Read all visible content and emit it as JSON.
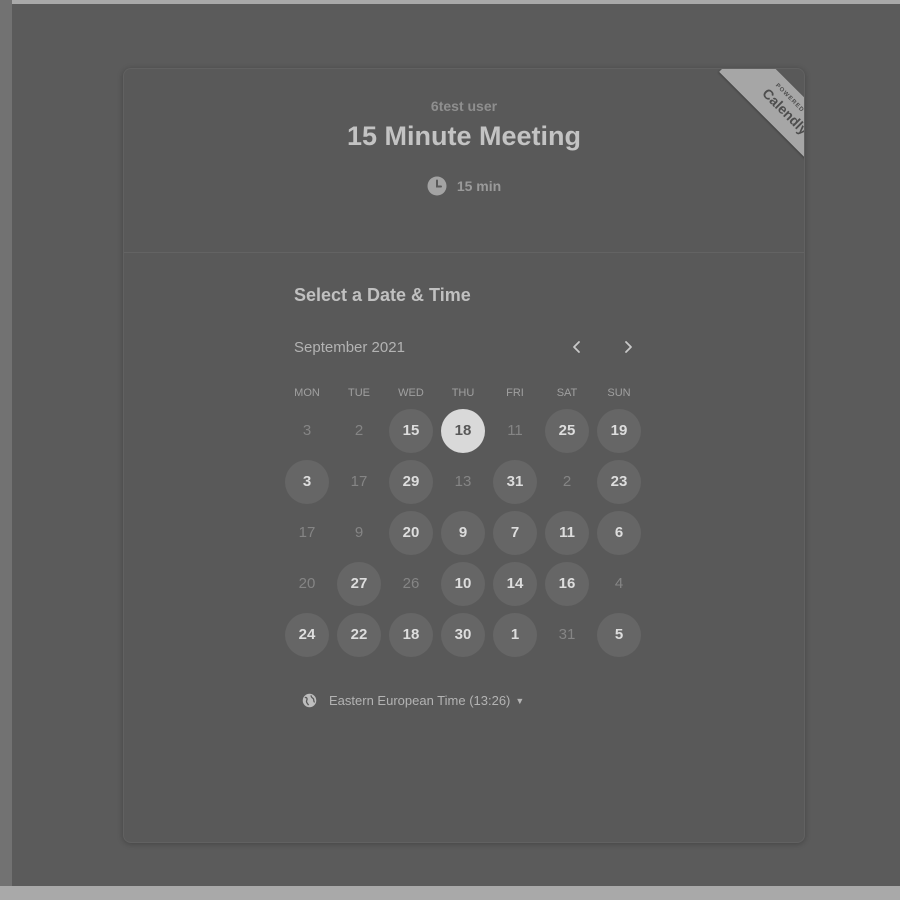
{
  "event": {
    "host_name": "6test user",
    "title": "15 Minute Meeting",
    "duration": "15 min"
  },
  "ribbon": {
    "powered_by": "POWERED BY",
    "brand": "Calendly"
  },
  "scheduler": {
    "section_title": "Select a Date & Time",
    "month_label": "September 2021",
    "prev_icon": "chevron-left",
    "next_icon": "chevron-right",
    "weekdays": [
      "MON",
      "TUE",
      "WED",
      "THU",
      "FRI",
      "SAT",
      "SUN"
    ],
    "weeks": [
      [
        {
          "label": "3",
          "state": "unavailable"
        },
        {
          "label": "2",
          "state": "unavailable"
        },
        {
          "label": "15",
          "state": "available"
        },
        {
          "label": "18",
          "state": "selected"
        },
        {
          "label": "11",
          "state": "unavailable"
        },
        {
          "label": "25",
          "state": "available"
        },
        {
          "label": "19",
          "state": "available"
        }
      ],
      [
        {
          "label": "3",
          "state": "available"
        },
        {
          "label": "17",
          "state": "unavailable"
        },
        {
          "label": "29",
          "state": "available"
        },
        {
          "label": "13",
          "state": "unavailable"
        },
        {
          "label": "31",
          "state": "available"
        },
        {
          "label": "2",
          "state": "unavailable"
        },
        {
          "label": "23",
          "state": "available"
        }
      ],
      [
        {
          "label": "17",
          "state": "unavailable"
        },
        {
          "label": "9",
          "state": "unavailable"
        },
        {
          "label": "20",
          "state": "available"
        },
        {
          "label": "9",
          "state": "available"
        },
        {
          "label": "7",
          "state": "available"
        },
        {
          "label": "11",
          "state": "available"
        },
        {
          "label": "6",
          "state": "available"
        }
      ],
      [
        {
          "label": "20",
          "state": "unavailable"
        },
        {
          "label": "27",
          "state": "available"
        },
        {
          "label": "26",
          "state": "unavailable"
        },
        {
          "label": "10",
          "state": "available"
        },
        {
          "label": "14",
          "state": "available"
        },
        {
          "label": "16",
          "state": "available"
        },
        {
          "label": "4",
          "state": "unavailable"
        }
      ],
      [
        {
          "label": "24",
          "state": "available"
        },
        {
          "label": "22",
          "state": "available"
        },
        {
          "label": "18",
          "state": "available"
        },
        {
          "label": "30",
          "state": "available"
        },
        {
          "label": "1",
          "state": "available"
        },
        {
          "label": "31",
          "state": "unavailable"
        },
        {
          "label": "5",
          "state": "available"
        }
      ]
    ],
    "timezone": "Eastern European Time (13:26)"
  },
  "colors": {
    "background": "#5b5b5b",
    "card": "#595959",
    "available_day": "#666666",
    "selected_day": "#d9d9d9",
    "ribbon": "#a6a6a6"
  }
}
